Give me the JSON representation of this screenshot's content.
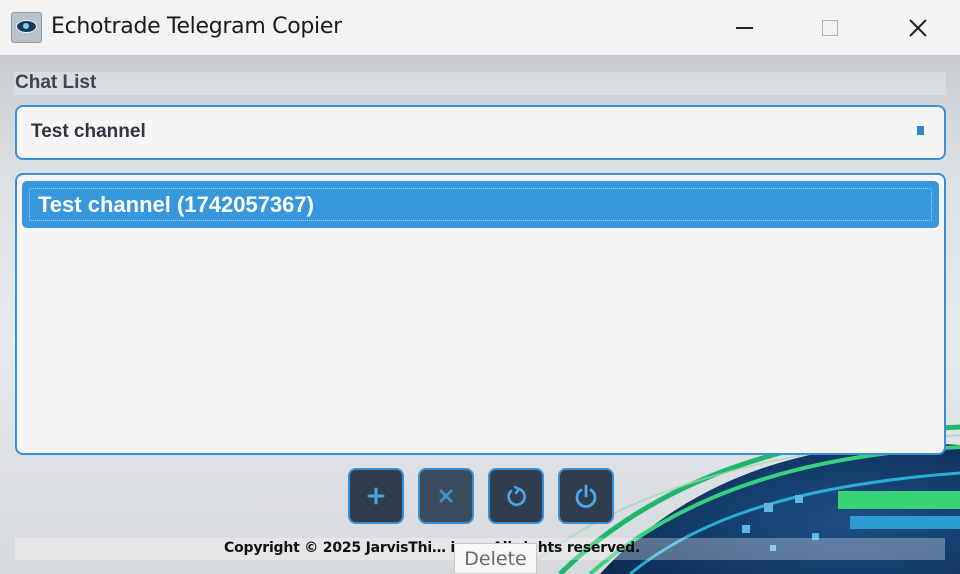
{
  "window": {
    "title": "Echotrade Telegram Copier",
    "icon": "app-eye-icon"
  },
  "chat_list": {
    "label": "Chat List",
    "selected_value": "Test channel",
    "items": [
      {
        "label": "Test channel (1742057367)",
        "selected": true
      }
    ]
  },
  "toolbar": {
    "buttons": [
      {
        "name": "add",
        "icon": "plus-icon"
      },
      {
        "name": "delete",
        "icon": "x-icon"
      },
      {
        "name": "refresh",
        "icon": "refresh-icon"
      },
      {
        "name": "power",
        "icon": "power-icon"
      }
    ]
  },
  "footer": {
    "copyright": "Copyright © 2025 JarvisThi… ions. All rights reserved."
  },
  "tooltip": {
    "text": "Delete"
  },
  "colors": {
    "accent": "#3a90d6",
    "selection": "#3797dc",
    "button_bg": "#2f3d4d",
    "icon": "#4aa8ec"
  }
}
